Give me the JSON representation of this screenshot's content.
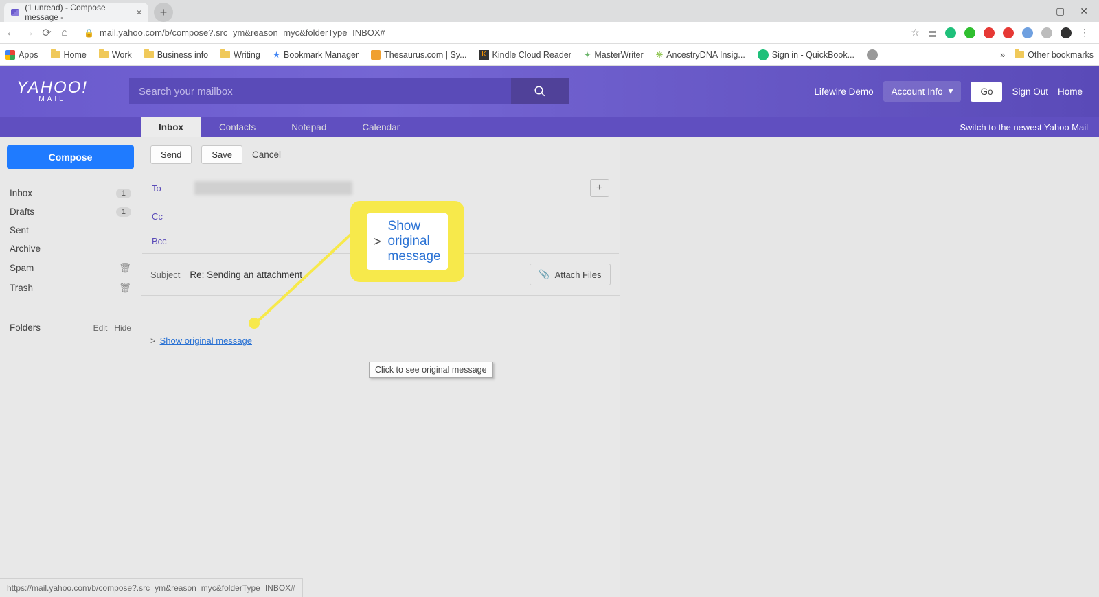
{
  "browser": {
    "tab_title": "(1 unread) - Compose message -",
    "url": "mail.yahoo.com/b/compose?.src=ym&reason=myc&folderType=INBOX#",
    "status_url": "https://mail.yahoo.com/b/compose?.src=ym&reason=myc&folderType=INBOX#"
  },
  "bookmarks": {
    "apps": "Apps",
    "items": [
      "Home",
      "Work",
      "Business info",
      "Writing",
      "Bookmark Manager",
      "Thesaurus.com | Sy...",
      "Kindle Cloud Reader",
      "MasterWriter",
      "AncestryDNA Insig...",
      "Sign in - QuickBook..."
    ],
    "other": "Other bookmarks",
    "chev": "»"
  },
  "yahoo": {
    "logo": "YAHOO!",
    "logo_sub": "MAIL",
    "search_ph": "Search your mailbox",
    "user": "Lifewire Demo",
    "account": "Account Info",
    "go": "Go",
    "signout": "Sign Out",
    "home": "Home",
    "tabs": [
      "Inbox",
      "Contacts",
      "Notepad",
      "Calendar"
    ],
    "switch": "Switch to the newest Yahoo Mail"
  },
  "sidebar": {
    "compose": "Compose",
    "folders": [
      {
        "name": "Inbox",
        "badge": "1"
      },
      {
        "name": "Drafts",
        "badge": "1"
      },
      {
        "name": "Sent"
      },
      {
        "name": "Archive"
      },
      {
        "name": "Spam",
        "trash": true
      },
      {
        "name": "Trash",
        "trash": true
      }
    ],
    "folders_label": "Folders",
    "edit": "Edit",
    "hide": "Hide"
  },
  "compose": {
    "send": "Send",
    "save": "Save",
    "cancel": "Cancel",
    "to": "To",
    "cc": "Cc",
    "bcc": "Bcc",
    "subject_label": "Subject",
    "subject": "Re: Sending an attachment",
    "attach": "Attach Files",
    "plus": "+",
    "show_original": "Show original message",
    "arrow": ">",
    "tooltip": "Click to see original message"
  },
  "callout": {
    "gt": ">",
    "text": "Show original message"
  }
}
